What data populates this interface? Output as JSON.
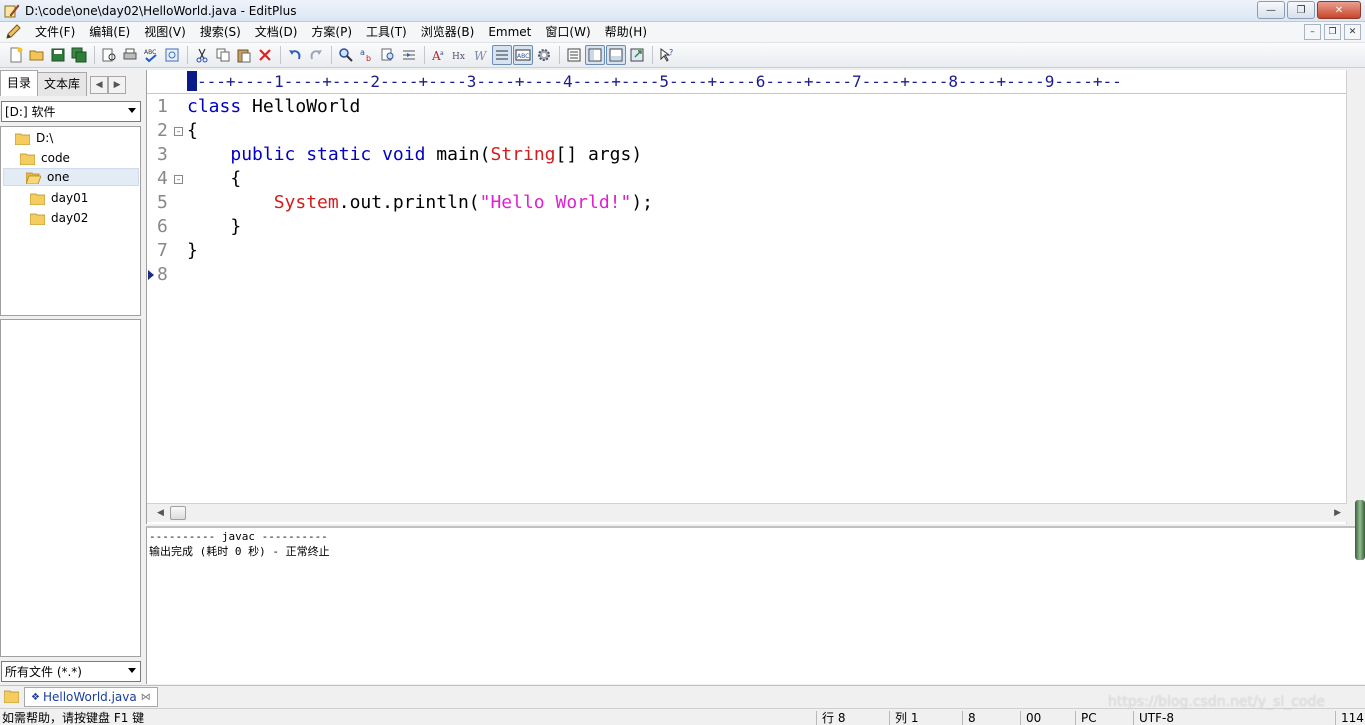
{
  "titlebar": {
    "title": "D:\\code\\one\\day02\\HelloWorld.java - EditPlus"
  },
  "menu": [
    "文件(F)",
    "编辑(E)",
    "视图(V)",
    "搜索(S)",
    "文档(D)",
    "方案(P)",
    "工具(T)",
    "浏览器(B)",
    "Emmet",
    "窗口(W)",
    "帮助(H)"
  ],
  "left_panel": {
    "tabs": [
      "目录",
      "文本库"
    ],
    "drive": "[D:] 软件",
    "tree": [
      {
        "label": "D:\\",
        "level": 0
      },
      {
        "label": "code",
        "level": 1
      },
      {
        "label": "one",
        "level": 2
      },
      {
        "label": "day01",
        "level": 3
      },
      {
        "label": "day02",
        "level": 3
      }
    ],
    "selected_item": "one",
    "filter": "所有文件 (*.*)"
  },
  "editor": {
    "ruler": "---+----1----+----2----+----3----+----4----+----5----+----6----+----7----+----8----+----9----+--",
    "line_numbers": [
      "1",
      "2",
      "3",
      "4",
      "5",
      "6",
      "7",
      "8"
    ],
    "code": {
      "l1_kw": "class",
      "l1_rest": " HelloWorld",
      "l2": "{",
      "l3_indent": "    ",
      "l3_kw": "public static void",
      "l3_mid": " main(",
      "l3_type": "String",
      "l3_rest": "[] args)",
      "l4": "    {",
      "l5_indent": "        ",
      "l5_type": "System",
      "l5_mid": ".out.println(",
      "l5_str": "\"Hello World!\"",
      "l5_end": ");",
      "l6": "    }",
      "l7": "}"
    }
  },
  "output": {
    "header": "---------- javac ----------",
    "result": "输出完成 (耗时 0 秒) - 正常终止"
  },
  "doc_tab": {
    "label": "HelloWorld.java"
  },
  "status": {
    "help": "如需帮助，请按键盘 F1 键",
    "row": "行 8",
    "col": "列 1",
    "lines": "8",
    "code": "00",
    "mode": "PC",
    "encoding": "UTF-8",
    "size": "114"
  },
  "watermark": "https://blog.csdn.net/y_sl_code",
  "colors": {
    "keyword": "#0000c8",
    "type": "#d41c1c",
    "string": "#e020d0"
  }
}
